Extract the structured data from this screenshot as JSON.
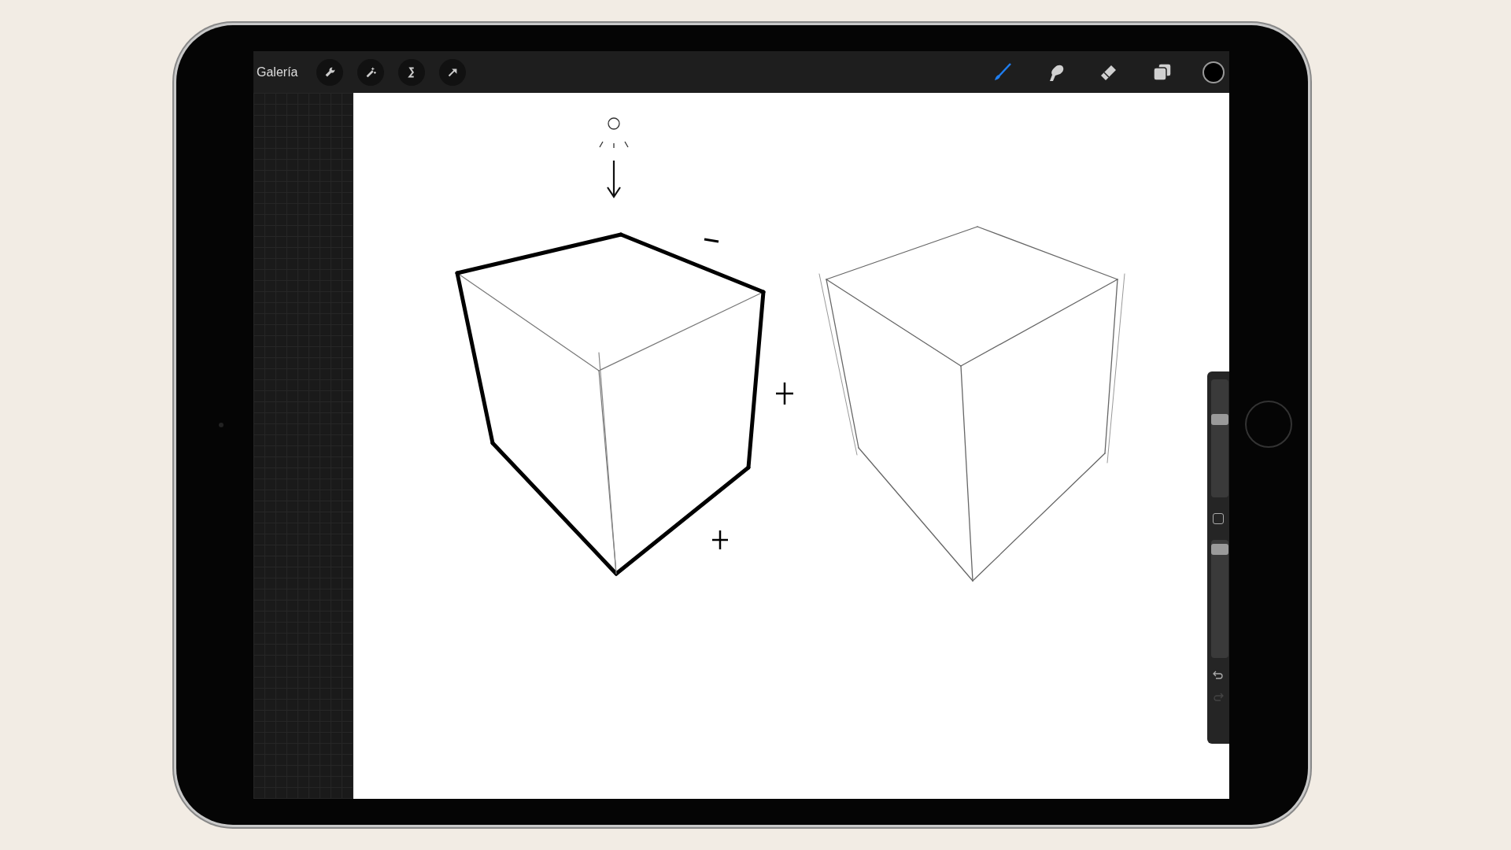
{
  "toolbar": {
    "gallery_label": "Galería",
    "actions": [
      {
        "kind": "wrench"
      },
      {
        "kind": "wand"
      },
      {
        "kind": "selection"
      },
      {
        "kind": "transform"
      }
    ],
    "tools": [
      {
        "kind": "brush",
        "selected": true
      },
      {
        "kind": "smudge",
        "selected": false
      },
      {
        "kind": "eraser",
        "selected": false
      },
      {
        "kind": "layers",
        "selected": false
      }
    ]
  },
  "sidebar": {
    "size_slider": {
      "level": 0.68
    },
    "opacity_slider": {
      "level": 0.96
    }
  }
}
